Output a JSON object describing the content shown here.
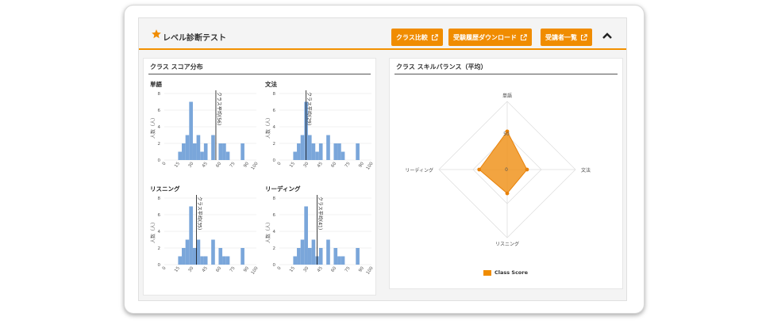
{
  "header": {
    "title": "レベル診断テスト",
    "buttons": [
      {
        "label": "クラス比較"
      },
      {
        "label": "受験履歴ダウンロード"
      },
      {
        "label": "受講者一覧"
      }
    ]
  },
  "score_card": {
    "title": "クラス スコア分布"
  },
  "radar_card": {
    "title": "クラス スキルバランス（平均）"
  },
  "colors": {
    "accent": "#f08c00",
    "bar": "#7aa6da",
    "radar_fill": "#f0941f"
  },
  "chart_data": [
    {
      "type": "bar",
      "title": "単語",
      "ylabel": "人数（人）",
      "ylim": [
        0,
        8
      ],
      "yticks": [
        0,
        2,
        4,
        6,
        8
      ],
      "xticks": [
        0,
        15,
        30,
        45,
        60,
        75,
        90,
        100
      ],
      "bin_start": 15,
      "bin_width": 4,
      "values": [
        1,
        2,
        3,
        7,
        2,
        3,
        1,
        2,
        0,
        3,
        0,
        2,
        2,
        1,
        0,
        0,
        0,
        2
      ],
      "mean_label": "クラス平均(56)",
      "mean": 56
    },
    {
      "type": "bar",
      "title": "文法",
      "ylabel": "人数（人）",
      "ylim": [
        0,
        8
      ],
      "yticks": [
        0,
        2,
        4,
        6,
        8
      ],
      "xticks": [
        0,
        15,
        30,
        45,
        60,
        75,
        90,
        100
      ],
      "bin_start": 15,
      "bin_width": 4,
      "values": [
        1,
        2,
        3,
        7,
        3,
        2,
        1,
        2,
        0,
        3,
        0,
        2,
        2,
        1,
        0,
        0,
        0,
        2
      ],
      "mean_label": "クラス平均(29)",
      "mean": 29
    },
    {
      "type": "bar",
      "title": "リスニング",
      "ylabel": "人数（人）",
      "ylim": [
        0,
        8
      ],
      "yticks": [
        0,
        2,
        4,
        6,
        8
      ],
      "xticks": [
        0,
        15,
        30,
        45,
        60,
        75,
        90,
        100
      ],
      "bin_start": 15,
      "bin_width": 4,
      "values": [
        1,
        2,
        3,
        7,
        2,
        3,
        1,
        1,
        0,
        3,
        0,
        2,
        1,
        1,
        0,
        0,
        0,
        2
      ],
      "mean_label": "クラス平均(35)",
      "mean": 35
    },
    {
      "type": "bar",
      "title": "リーディング",
      "ylabel": "人数（人）",
      "ylim": [
        0,
        8
      ],
      "yticks": [
        0,
        2,
        4,
        6,
        8
      ],
      "xticks": [
        0,
        15,
        30,
        45,
        60,
        75,
        90,
        100
      ],
      "bin_start": 15,
      "bin_width": 4,
      "values": [
        1,
        2,
        3,
        7,
        2,
        3,
        1,
        2,
        0,
        3,
        0,
        2,
        1,
        1,
        0,
        0,
        0,
        2
      ],
      "mean_label": "クラス平均(41)",
      "mean": 41
    },
    {
      "type": "radar",
      "axes": [
        "単語",
        "文法",
        "リスニング",
        "リーディング"
      ],
      "rmax": 100,
      "ring_labels": [
        "0",
        "50"
      ],
      "series": [
        {
          "name": "Class Score",
          "values": [
            56,
            29,
            35,
            41
          ]
        }
      ]
    }
  ]
}
